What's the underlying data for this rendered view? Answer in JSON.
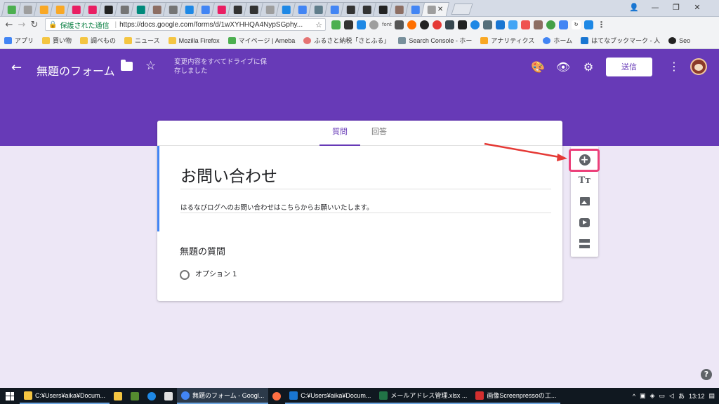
{
  "browser": {
    "active_tab_close": "✕",
    "window_controls": [
      "👤",
      "—",
      "❐",
      "✕"
    ],
    "url_secure_label": "保護された通信",
    "url": "https://docs.google.com/forms/d/1wXYHHQA4NypSGphy...",
    "ext_font_label": "font"
  },
  "bookmarks": [
    {
      "label": "アプリ",
      "color": "#4285f4"
    },
    {
      "label": "買い物",
      "color": "#f4c542"
    },
    {
      "label": "調べもの",
      "color": "#f4c542"
    },
    {
      "label": "ニュース",
      "color": "#f4c542"
    },
    {
      "label": "Mozilla Firefox",
      "color": "#f4c542"
    },
    {
      "label": "マイページ | Ameba",
      "color": "#4caf50"
    },
    {
      "label": "ふるさと納税「さとふる」",
      "color": "#e57373"
    },
    {
      "label": "Search Console - ホー",
      "color": "#78909c"
    },
    {
      "label": "アナリティクス",
      "color": "#f9a825"
    },
    {
      "label": "ホーム",
      "color": "#4285f4"
    },
    {
      "label": "はてなブックマーク - 人",
      "color": "#1976d2"
    },
    {
      "label": "Seo",
      "color": "#222222"
    }
  ],
  "forms": {
    "back_icon": "←",
    "form_title": "無題のフォーム",
    "star_icon": "☆",
    "saved_status": "変更内容をすべてドライブに保存しました",
    "send_label": "送信",
    "more_icon": "⋮",
    "palette_icon": "🎨",
    "preview_icon": "👁",
    "settings_icon": "⚙",
    "tabs": [
      "質問",
      "回答"
    ],
    "title": "お問い合わせ",
    "description": "はるなびログへのお問い合わせはこちらからお願いいたします。",
    "question_title": "無題の質問",
    "option_label": "オプション 1",
    "toolbar_add": "+",
    "toolbar_title": "Tт",
    "help": "?"
  },
  "taskbar": {
    "items": [
      {
        "label": "C:¥Users¥aika¥Docum...",
        "color": "#f4c542"
      },
      {
        "label": "無題のフォーム - Googl...",
        "color": "#4285f4",
        "active": true
      },
      {
        "label": "C:¥Users¥aika¥Docum...",
        "color": "#1976d2"
      },
      {
        "label": "メールアドレス管理.xlsx ...",
        "color": "#217346"
      },
      {
        "label": "画像Screenpressoの工...",
        "color": "#d32f2f"
      }
    ],
    "tray_ime": "あ",
    "clock": "13:12"
  },
  "colors": {
    "accent": "#673ab7",
    "highlight": "#ec407a",
    "title_border": "#4285f4",
    "arrow": "#e53935"
  }
}
